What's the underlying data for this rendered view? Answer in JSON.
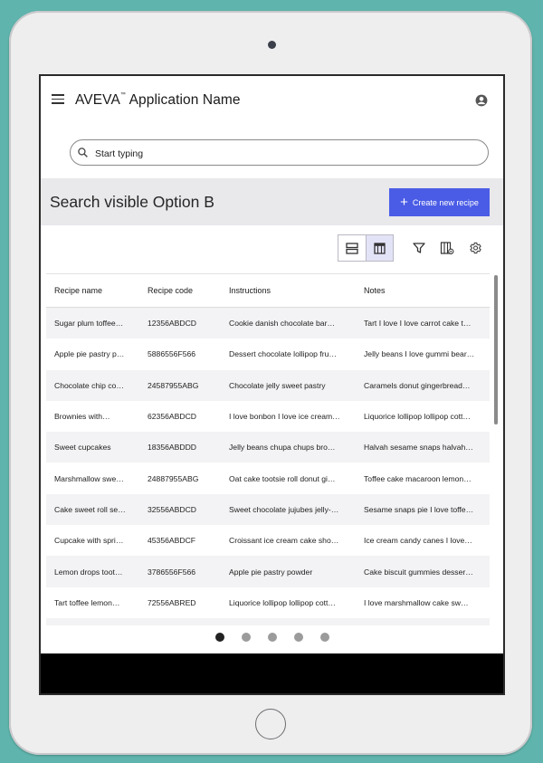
{
  "header": {
    "app_title": "AVEVA",
    "trademark": "™",
    "app_subtitle": " Application Name",
    "menu_icon": "hamburger-menu-icon",
    "account_icon": "account-circle-icon"
  },
  "search": {
    "placeholder": "Start typing",
    "value": ""
  },
  "banner": {
    "title": "Search visible Option B",
    "create_button_label": "Create new recipe",
    "create_button_color": "#4a5ce6"
  },
  "toolbar": {
    "view_options": [
      "list-view-icon",
      "table-view-icon"
    ],
    "active_view": "table-view-icon",
    "tools": [
      "filter-icon",
      "column-settings-icon",
      "gear-icon"
    ]
  },
  "table": {
    "columns": [
      "Recipe name",
      "Recipe code",
      "Instructions",
      "Notes"
    ],
    "rows": [
      [
        "Sugar plum toffee…",
        "12356ABDCD",
        "Cookie danish chocolate bar…",
        "Tart I love I love carrot cake t…"
      ],
      [
        "Apple pie pastry p…",
        "5886556F566",
        "Dessert chocolate lollipop fru…",
        "Jelly beans I love gummi bear…"
      ],
      [
        "Chocolate chip co…",
        "24587955ABG",
        "Chocolate jelly sweet pastry",
        "Caramels donut gingerbread…"
      ],
      [
        "Brownies with…",
        "62356ABDCD",
        "I love bonbon I love ice cream…",
        "Liquorice lollipop lollipop cott…"
      ],
      [
        "Sweet cupcakes",
        "18356ABDDD",
        "Jelly beans chupa chups bro…",
        "Halvah sesame snaps halvah…"
      ],
      [
        "Marshmallow swe…",
        "24887955ABG",
        "Oat cake tootsie roll donut gi…",
        "Toffee cake macaroon lemon…"
      ],
      [
        "Cake sweet roll se…",
        "32556ABDCD",
        "Sweet chocolate jujubes jelly-…",
        "Sesame snaps pie I love toffe…"
      ],
      [
        "Cupcake with spri…",
        "45356ABDCF",
        "Croissant ice cream cake sho…",
        "Ice cream candy canes I love…"
      ],
      [
        "Lemon drops toot…",
        "3786556F566",
        "Apple pie pastry powder",
        "Cake biscuit gummies desser…"
      ],
      [
        "Tart toffee lemon…",
        "72556ABRED",
        "Liquorice lollipop lollipop cott…",
        " I love marshmallow cake sw…"
      ]
    ]
  },
  "pagination": {
    "pages": 5,
    "current_page": 1
  }
}
